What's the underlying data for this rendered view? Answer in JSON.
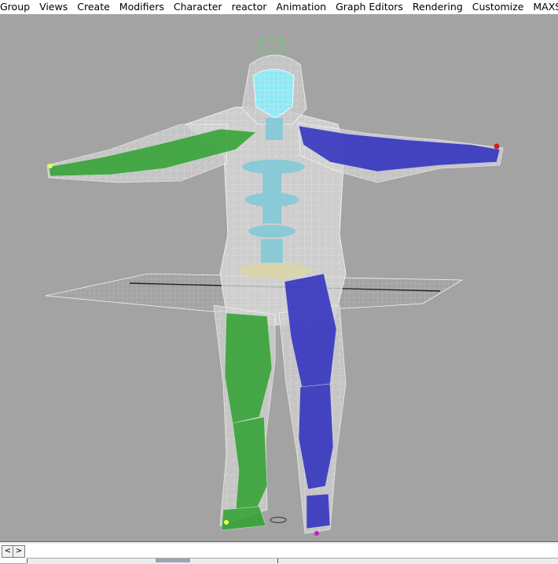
{
  "menubar": {
    "items": [
      "Group",
      "Views",
      "Create",
      "Modifiers",
      "Character",
      "reactor",
      "Animation",
      "Graph Editors",
      "Rendering",
      "Customize",
      "MAXScript"
    ]
  },
  "viewport": {
    "background": "#a3a3a3",
    "scene": "rigged character mesh in T-pose with biped skeleton"
  },
  "timebar": {
    "prev_label": "<",
    "next_label": ">"
  },
  "colors": {
    "left_limb": "#2fa12f",
    "right_limb": "#2d2dc0",
    "spine": "#7fc9d8",
    "mesh": "#e4e4e4"
  }
}
